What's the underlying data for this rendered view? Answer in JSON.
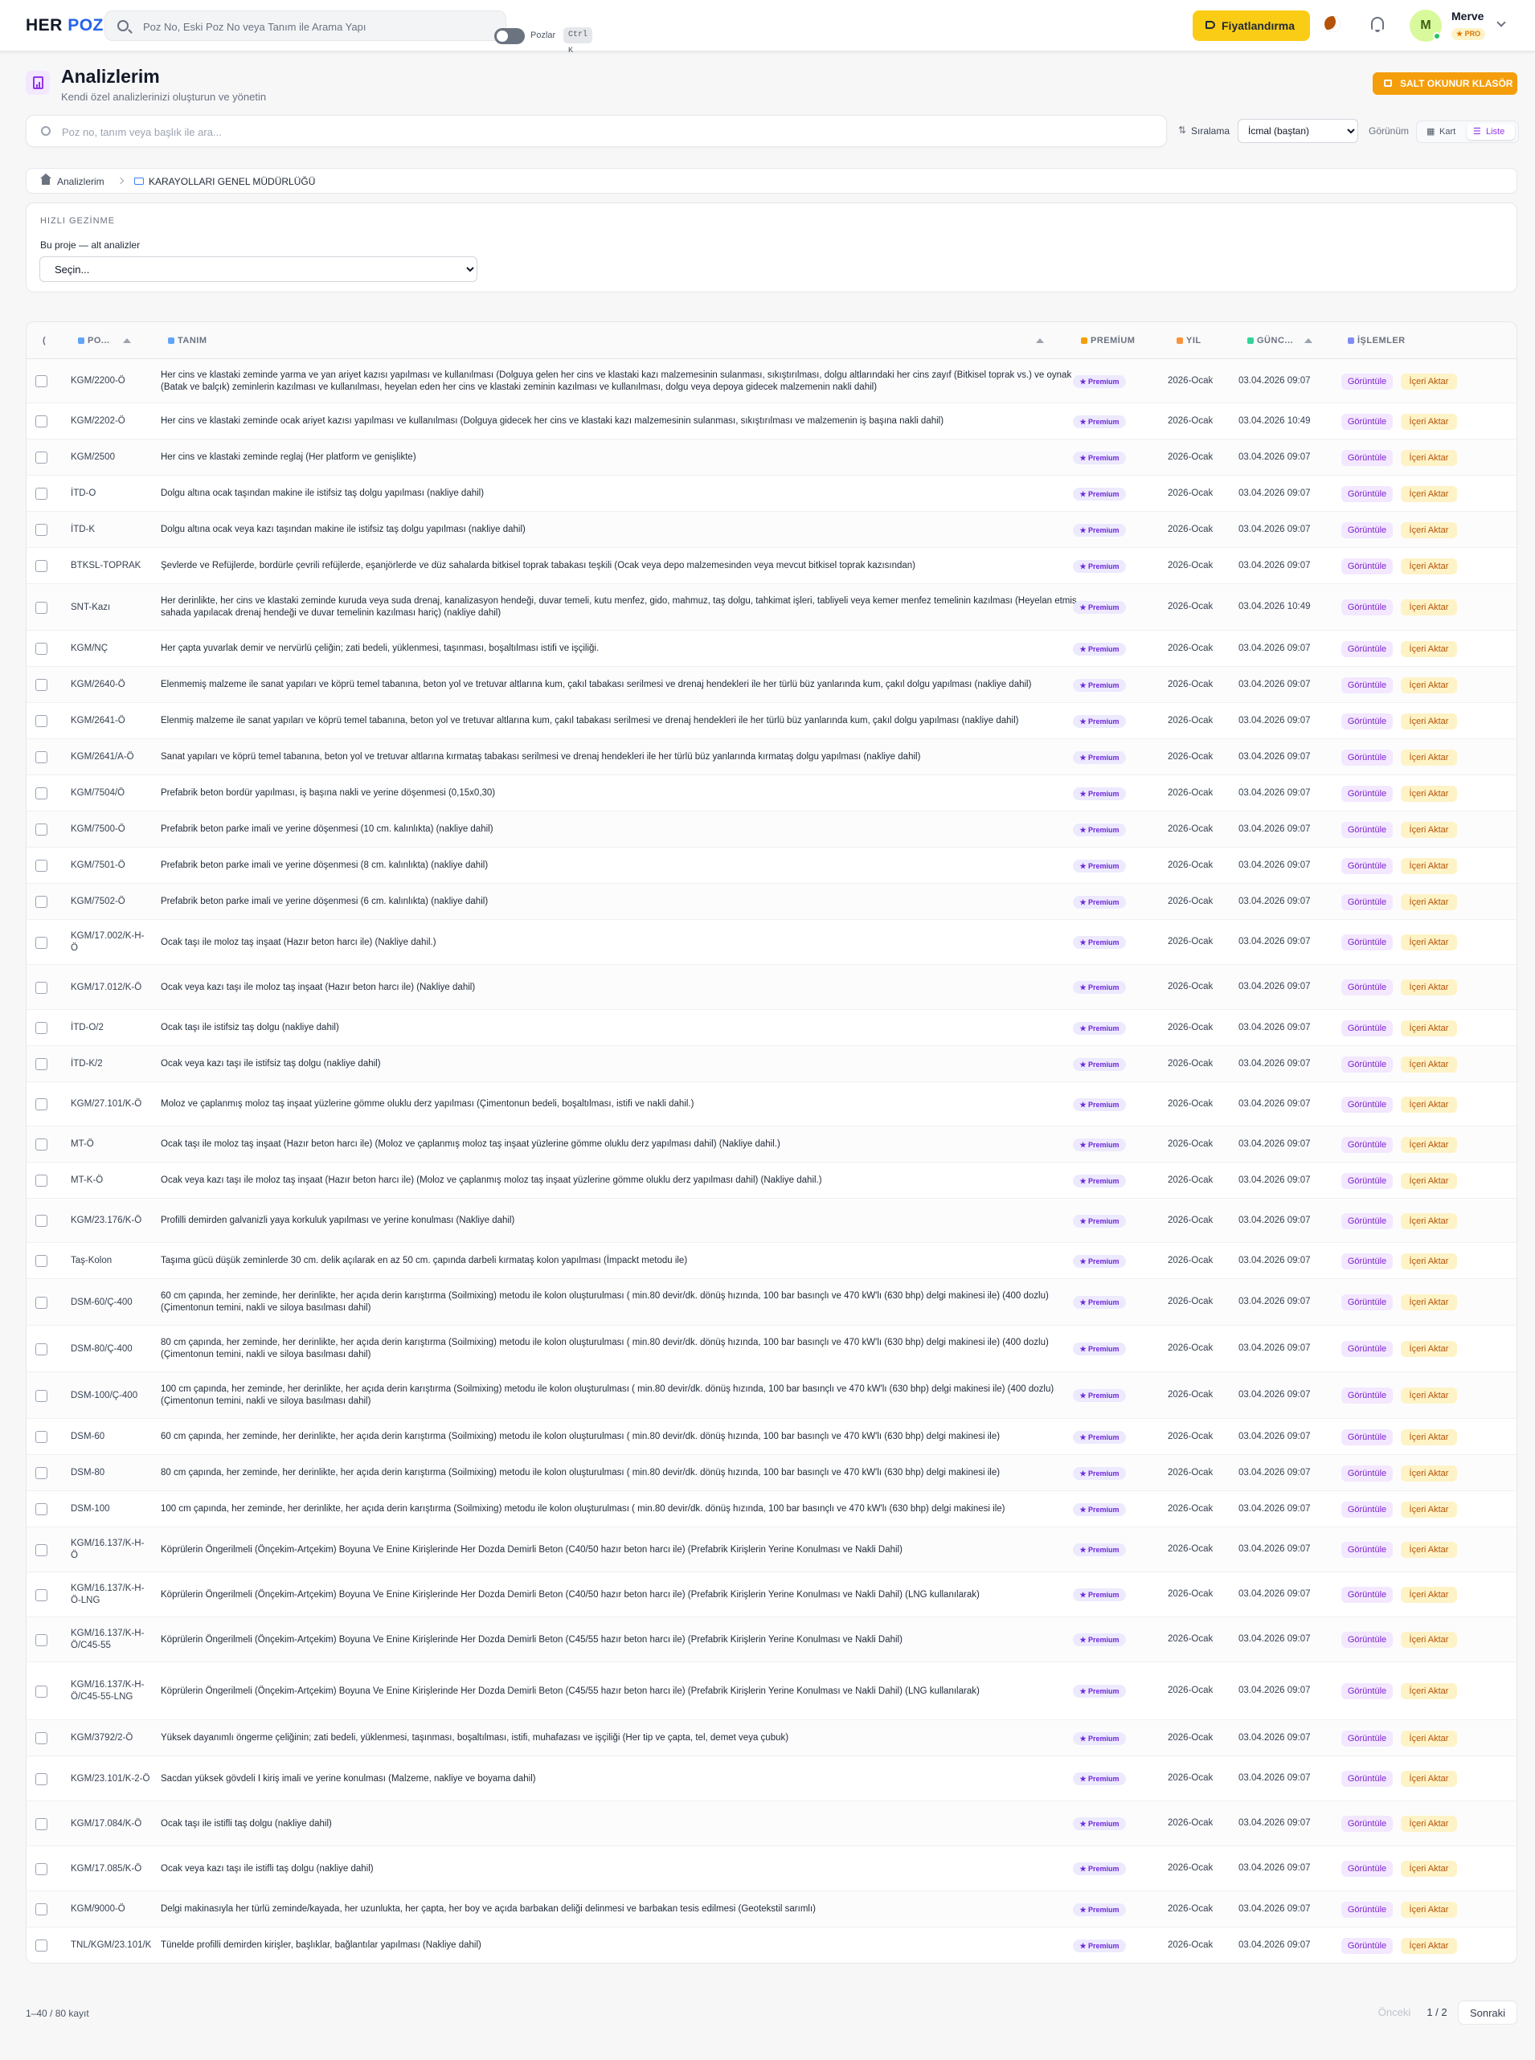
{
  "topbar": {
    "logo_a": "HER",
    "logo_b": "POZ",
    "search_placeholder": "Poz No, Eski Poz No veya Tanım ile Arama Yapı",
    "toggle_label": "Pozlar",
    "shortcut": "Ctrl K",
    "pricing_label": "Fiyatlandırma",
    "user_initial": "M",
    "user_name": "Merve",
    "user_plan": "★ PRO"
  },
  "header": {
    "title": "Analizlerim",
    "subtitle": "Kendi özel analizlerinizi oluşturun ve yönetin",
    "readonly_label": "SALT OKUNUR KLASÖR"
  },
  "filter": {
    "search_placeholder": "Poz no, tanım veya başlık ile ara...",
    "sort_label": "Sıralama",
    "sort_value": "İcmal (baştan)",
    "view_label": "Görünüm",
    "view_card": "Kart",
    "view_list": "Liste"
  },
  "breadcrumb": {
    "root": "Analizlerim",
    "current": "KARAYOLLARI GENEL MÜDÜRLÜĞÜ"
  },
  "quick_nav": {
    "title": "HIZLI GEZİNME",
    "label": "Bu proje — alt analizler",
    "select_value": "Seçin..."
  },
  "table": {
    "headers": {
      "sel": "(",
      "poz": "PO...",
      "tanim": "TANIM",
      "premium": "PREMİUM",
      "yil": "YIL",
      "guncel": "GÜNC...",
      "islemler": "İŞLEMLER"
    },
    "rows": [
      {
        "poz": "KGM/2200-Ö",
        "tanim": "Her cins ve klastaki zeminde yarma ve yan ariyet kazısı yapılması ve kullanılması (Dolguya gelen her cins ve klastaki kazı malzemesinin sulanması, sıkıştırılması, dolgu altlarındaki her cins zayıf (Bitkisel toprak vs.) ve oynak (Batak ve balçık) zeminlerin kazılması ve kullanılması, heyelan eden her cins ve klastaki zeminin kazılması ve kullanılması, dolgu veya depoya gidecek malzemenin nakli dahil)",
        "premium": "★ Premium",
        "yil": "2026-Ocak",
        "guncel": "03.04.2026 09:07",
        "view": "Görüntüle",
        "import": "İçeri Aktar"
      },
      {
        "poz": "KGM/2202-Ö",
        "tanim": "Her cins ve klastaki zeminde ocak ariyet kazısı yapılması ve kullanılması (Dolguya gidecek her cins ve klastaki kazı malzemesinin sulanması, sıkıştırılması ve malzemenin iş başına nakli dahil)",
        "premium": "★ Premium",
        "yil": "2026-Ocak",
        "guncel": "03.04.2026 10:49",
        "view": "Görüntüle",
        "import": "İçeri Aktar"
      },
      {
        "poz": "KGM/2500",
        "tanim": "Her cins ve klastaki zeminde reglaj (Her platform ve genişlikte)",
        "premium": "★ Premium",
        "yil": "2026-Ocak",
        "guncel": "03.04.2026 09:07",
        "view": "Görüntüle",
        "import": "İçeri Aktar"
      },
      {
        "poz": "İTD-O",
        "tanim": "Dolgu altına ocak taşından makine ile istifsiz taş dolgu yapılması (nakliye dahil)",
        "premium": "★ Premium",
        "yil": "2026-Ocak",
        "guncel": "03.04.2026 09:07",
        "view": "Görüntüle",
        "import": "İçeri Aktar"
      },
      {
        "poz": "İTD-K",
        "tanim": "Dolgu altına ocak veya kazı taşından makine ile istifsiz taş dolgu yapılması (nakliye dahil)",
        "premium": "★ Premium",
        "yil": "2026-Ocak",
        "guncel": "03.04.2026 09:07",
        "view": "Görüntüle",
        "import": "İçeri Aktar"
      },
      {
        "poz": "BTKSL-TOPRAK",
        "tanim": "Şevlerde ve Refüjlerde, bordürle çevrili refüjlerde, eşanjörlerde ve düz sahalarda bitkisel toprak tabakası teşkili (Ocak veya depo malzemesinden veya mevcut bitkisel toprak kazısından)",
        "premium": "★ Premium",
        "yil": "2026-Ocak",
        "guncel": "03.04.2026 09:07",
        "view": "Görüntüle",
        "import": "İçeri Aktar"
      },
      {
        "poz": "SNT-Kazı",
        "tanim": "Her derinlikte, her cins ve klastaki zeminde kuruda veya suda drenaj, kanalizasyon hendeği, duvar temeli, kutu menfez, gido, mahmuz, taş dolgu, tahkimat işleri, tabliyeli veya kemer menfez temelinin kazılması (Heyelan etmiş sahada yapılacak drenaj hendeği ve duvar temelinin kazılması hariç) (nakliye dahil)",
        "premium": "★ Premium",
        "yil": "2026-Ocak",
        "guncel": "03.04.2026 10:49",
        "view": "Görüntüle",
        "import": "İçeri Aktar"
      },
      {
        "poz": "KGM/NÇ",
        "tanim": "Her çapta yuvarlak demir ve nervürlü çeliğin; zati bedeli, yüklenmesi, taşınması, boşaltılması istifi ve işçiliği.",
        "premium": "★ Premium",
        "yil": "2026-Ocak",
        "guncel": "03.04.2026 09:07",
        "view": "Görüntüle",
        "import": "İçeri Aktar"
      },
      {
        "poz": "KGM/2640-Ö",
        "tanim": "Elenmemiş malzeme ile sanat yapıları ve köprü temel tabanına, beton yol ve tretuvar altlarına kum, çakıl tabakası serilmesi ve drenaj hendekleri ile her türlü büz yanlarında kum, çakıl dolgu yapılması (nakliye dahil)",
        "premium": "★ Premium",
        "yil": "2026-Ocak",
        "guncel": "03.04.2026 09:07",
        "view": "Görüntüle",
        "import": "İçeri Aktar"
      },
      {
        "poz": "KGM/2641-Ö",
        "tanim": "Elenmiş malzeme ile sanat yapıları ve köprü temel tabanına, beton yol ve tretuvar altlarına kum, çakıl tabakası serilmesi ve drenaj hendekleri ile her türlü büz yanlarında kum, çakıl dolgu yapılması (nakliye dahil)",
        "premium": "★ Premium",
        "yil": "2026-Ocak",
        "guncel": "03.04.2026 09:07",
        "view": "Görüntüle",
        "import": "İçeri Aktar"
      },
      {
        "poz": "KGM/2641/A-Ö",
        "tanim": "Sanat yapıları ve köprü temel tabanına, beton yol ve tretuvar altlarına kırmataş tabakası serilmesi ve drenaj hendekleri ile her türlü büz yanlarında kırmataş dolgu yapılması (nakliye dahil)",
        "premium": "★ Premium",
        "yil": "2026-Ocak",
        "guncel": "03.04.2026 09:07",
        "view": "Görüntüle",
        "import": "İçeri Aktar"
      },
      {
        "poz": "KGM/7504/Ö",
        "tanim": "Prefabrik beton bordür yapılması, iş başına nakli ve yerine döşenmesi (0,15x0,30)",
        "premium": "★ Premium",
        "yil": "2026-Ocak",
        "guncel": "03.04.2026 09:07",
        "view": "Görüntüle",
        "import": "İçeri Aktar"
      },
      {
        "poz": "KGM/7500-Ö",
        "tanim": "Prefabrik beton parke imali ve yerine döşenmesi (10 cm. kalınlıkta) (nakliye dahil)",
        "premium": "★ Premium",
        "yil": "2026-Ocak",
        "guncel": "03.04.2026 09:07",
        "view": "Görüntüle",
        "import": "İçeri Aktar"
      },
      {
        "poz": "KGM/7501-Ö",
        "tanim": "Prefabrik beton parke imali ve yerine döşenmesi (8 cm. kalınlıkta) (nakliye dahil)",
        "premium": "★ Premium",
        "yil": "2026-Ocak",
        "guncel": "03.04.2026 09:07",
        "view": "Görüntüle",
        "import": "İçeri Aktar"
      },
      {
        "poz": "KGM/7502-Ö",
        "tanim": "Prefabrik beton parke imali ve yerine döşenmesi (6 cm. kalınlıkta) (nakliye dahil)",
        "premium": "★ Premium",
        "yil": "2026-Ocak",
        "guncel": "03.04.2026 09:07",
        "view": "Görüntüle",
        "import": "İçeri Aktar"
      },
      {
        "poz": "KGM/17.002/K-H-Ö",
        "tanim": "Ocak taşı ile moloz taş inşaat (Hazır beton harcı ile) (Nakliye dahil.)",
        "premium": "★ Premium",
        "yil": "2026-Ocak",
        "guncel": "03.04.2026 09:07",
        "view": "Görüntüle",
        "import": "İçeri Aktar"
      },
      {
        "poz": "KGM/17.012/K-Ö",
        "tanim": "Ocak veya kazı taşı ile moloz taş inşaat (Hazır beton harcı ile) (Nakliye dahil)",
        "premium": "★ Premium",
        "yil": "2026-Ocak",
        "guncel": "03.04.2026 09:07",
        "view": "Görüntüle",
        "import": "İçeri Aktar"
      },
      {
        "poz": "İTD-O/2",
        "tanim": "Ocak taşı ile istifsiz taş dolgu (nakliye dahil)",
        "premium": "★ Premium",
        "yil": "2026-Ocak",
        "guncel": "03.04.2026 09:07",
        "view": "Görüntüle",
        "import": "İçeri Aktar"
      },
      {
        "poz": "İTD-K/2",
        "tanim": "Ocak veya kazı taşı ile istifsiz taş dolgu (nakliye dahil)",
        "premium": "★ Premium",
        "yil": "2026-Ocak",
        "guncel": "03.04.2026 09:07",
        "view": "Görüntüle",
        "import": "İçeri Aktar"
      },
      {
        "poz": "KGM/27.101/K-Ö",
        "tanim": "Moloz ve çaplanmış moloz taş inşaat yüzlerine gömme oluklu derz yapılması (Çimentonun bedeli, boşaltılması, istifi ve nakli dahil.)",
        "premium": "★ Premium",
        "yil": "2026-Ocak",
        "guncel": "03.04.2026 09:07",
        "view": "Görüntüle",
        "import": "İçeri Aktar"
      },
      {
        "poz": "MT-Ö",
        "tanim": "Ocak taşı ile moloz taş inşaat (Hazır beton harcı ile) (Moloz ve çaplanmış moloz taş inşaat yüzlerine gömme oluklu derz yapılması dahil) (Nakliye dahil.)",
        "premium": "★ Premium",
        "yil": "2026-Ocak",
        "guncel": "03.04.2026 09:07",
        "view": "Görüntüle",
        "import": "İçeri Aktar"
      },
      {
        "poz": "MT-K-Ö",
        "tanim": "Ocak veya kazı taşı ile moloz taş inşaat (Hazır beton harcı ile) (Moloz ve çaplanmış moloz taş inşaat yüzlerine gömme oluklu derz yapılması dahil) (Nakliye dahil.)",
        "premium": "★ Premium",
        "yil": "2026-Ocak",
        "guncel": "03.04.2026 09:07",
        "view": "Görüntüle",
        "import": "İçeri Aktar"
      },
      {
        "poz": "KGM/23.176/K-Ö",
        "tanim": "Profilli demirden galvanizli yaya korkuluk yapılması ve yerine konulması (Nakliye dahil)",
        "premium": "★ Premium",
        "yil": "2026-Ocak",
        "guncel": "03.04.2026 09:07",
        "view": "Görüntüle",
        "import": "İçeri Aktar"
      },
      {
        "poz": "Taş-Kolon",
        "tanim": "Taşıma gücü düşük zeminlerde 30 cm. delik açılarak en az 50 cm. çapında darbeli kırmataş kolon yapılması (İmpackt metodu ile)",
        "premium": "★ Premium",
        "yil": "2026-Ocak",
        "guncel": "03.04.2026 09:07",
        "view": "Görüntüle",
        "import": "İçeri Aktar"
      },
      {
        "poz": "DSM-60/Ç-400",
        "tanim": "60 cm çapında, her zeminde, her derinlikte, her açıda derin karıştırma (Soilmixing) metodu ile kolon oluşturulması ( min.80 devir/dk. dönüş hızında, 100 bar basınçlı ve 470 kW'lı (630 bhp) delgi makinesi ile) (400 dozlu) (Çimentonun temini, nakli ve siloya basılması dahil)",
        "premium": "★ Premium",
        "yil": "2026-Ocak",
        "guncel": "03.04.2026 09:07",
        "view": "Görüntüle",
        "import": "İçeri Aktar"
      },
      {
        "poz": "DSM-80/Ç-400",
        "tanim": "80 cm çapında, her zeminde, her derinlikte, her açıda derin karıştırma (Soilmixing) metodu ile kolon oluşturulması ( min.80 devir/dk. dönüş hızında, 100 bar basınçlı ve 470 kW'lı (630 bhp) delgi makinesi ile) (400 dozlu) (Çimentonun temini, nakli ve siloya basılması dahil)",
        "premium": "★ Premium",
        "yil": "2026-Ocak",
        "guncel": "03.04.2026 09:07",
        "view": "Görüntüle",
        "import": "İçeri Aktar"
      },
      {
        "poz": "DSM-100/Ç-400",
        "tanim": "100 cm çapında, her zeminde, her derinlikte, her açıda derin karıştırma (Soilmixing) metodu ile kolon oluşturulması ( min.80 devir/dk. dönüş hızında, 100 bar basınçlı ve 470 kW'lı (630 bhp) delgi makinesi ile) (400 dozlu) (Çimentonun temini, nakli ve siloya basılması dahil)",
        "premium": "★ Premium",
        "yil": "2026-Ocak",
        "guncel": "03.04.2026 09:07",
        "view": "Görüntüle",
        "import": "İçeri Aktar"
      },
      {
        "poz": "DSM-60",
        "tanim": "60 cm çapında, her zeminde, her derinlikte, her açıda derin karıştırma (Soilmixing) metodu ile kolon oluşturulması ( min.80 devir/dk. dönüş hızında, 100 bar basınçlı ve 470 kW'lı (630 bhp) delgi makinesi ile)",
        "premium": "★ Premium",
        "yil": "2026-Ocak",
        "guncel": "03.04.2026 09:07",
        "view": "Görüntüle",
        "import": "İçeri Aktar"
      },
      {
        "poz": "DSM-80",
        "tanim": "80 cm çapında, her zeminde, her derinlikte, her açıda derin karıştırma (Soilmixing) metodu ile kolon oluşturulması ( min.80 devir/dk. dönüş hızında, 100 bar basınçlı ve 470 kW'lı (630 bhp) delgi makinesi ile)",
        "premium": "★ Premium",
        "yil": "2026-Ocak",
        "guncel": "03.04.2026 09:07",
        "view": "Görüntüle",
        "import": "İçeri Aktar"
      },
      {
        "poz": "DSM-100",
        "tanim": "100 cm çapında, her zeminde, her derinlikte, her açıda derin karıştırma (Soilmixing) metodu ile kolon oluşturulması ( min.80 devir/dk. dönüş hızında, 100 bar basınçlı ve 470 kW'lı (630 bhp) delgi makinesi ile)",
        "premium": "★ Premium",
        "yil": "2026-Ocak",
        "guncel": "03.04.2026 09:07",
        "view": "Görüntüle",
        "import": "İçeri Aktar"
      },
      {
        "poz": "KGM/16.137/K-H-Ö",
        "tanim": "Köprülerin Öngerilmeli (Önçekim-Artçekim) Boyuna Ve Enine Kirişlerinde Her Dozda Demirli Beton (C40/50 hazır beton harcı ile) (Prefabrik Kirişlerin Yerine Konulması ve Nakli Dahil)",
        "premium": "★ Premium",
        "yil": "2026-Ocak",
        "guncel": "03.04.2026 09:07",
        "view": "Görüntüle",
        "import": "İçeri Aktar"
      },
      {
        "poz": "KGM/16.137/K-H-Ö-LNG",
        "tanim": "Köprülerin Öngerilmeli (Önçekim-Artçekim) Boyuna Ve Enine Kirişlerinde Her Dozda Demirli Beton (C40/50 hazır beton harcı ile) (Prefabrik Kirişlerin Yerine Konulması ve Nakli Dahil) (LNG kullanılarak)",
        "premium": "★ Premium",
        "yil": "2026-Ocak",
        "guncel": "03.04.2026 09:07",
        "view": "Görüntüle",
        "import": "İçeri Aktar"
      },
      {
        "poz": "KGM/16.137/K-H-Ö/C45-55",
        "tanim": "Köprülerin Öngerilmeli (Önçekim-Artçekim) Boyuna Ve Enine Kirişlerinde Her Dozda Demirli Beton (C45/55 hazır beton harcı ile) (Prefabrik Kirişlerin Yerine Konulması ve Nakli Dahil)",
        "premium": "★ Premium",
        "yil": "2026-Ocak",
        "guncel": "03.04.2026 09:07",
        "view": "Görüntüle",
        "import": "İçeri Aktar"
      },
      {
        "poz": "KGM/16.137/K-H-Ö/C45-55-LNG",
        "tanim": "Köprülerin Öngerilmeli (Önçekim-Artçekim) Boyuna Ve Enine Kirişlerinde Her Dozda Demirli Beton (C45/55 hazır beton harcı ile) (Prefabrik Kirişlerin Yerine Konulması ve Nakli Dahil) (LNG kullanılarak)",
        "premium": "★ Premium",
        "yil": "2026-Ocak",
        "guncel": "03.04.2026 09:07",
        "view": "Görüntüle",
        "import": "İçeri Aktar"
      },
      {
        "poz": "KGM/3792/2-Ö",
        "tanim": "Yüksek dayanımlı öngerme çeliğinin; zati bedeli, yüklenmesi, taşınması, boşaltılması, istifi, muhafazası ve işçiliği (Her tip ve çapta, tel, demet veya çubuk)",
        "premium": "★ Premium",
        "yil": "2026-Ocak",
        "guncel": "03.04.2026 09:07",
        "view": "Görüntüle",
        "import": "İçeri Aktar"
      },
      {
        "poz": "KGM/23.101/K-2-Ö",
        "tanim": "Sacdan yüksek gövdeli I kiriş imali ve yerine konulması (Malzeme, nakliye ve boyama dahil)",
        "premium": "★ Premium",
        "yil": "2026-Ocak",
        "guncel": "03.04.2026 09:07",
        "view": "Görüntüle",
        "import": "İçeri Aktar"
      },
      {
        "poz": "KGM/17.084/K-Ö",
        "tanim": "Ocak taşı ile istifli taş dolgu (nakliye dahil)",
        "premium": "★ Premium",
        "yil": "2026-Ocak",
        "guncel": "03.04.2026 09:07",
        "view": "Görüntüle",
        "import": "İçeri Aktar"
      },
      {
        "poz": "KGM/17.085/K-Ö",
        "tanim": "Ocak veya kazı taşı ile istifli taş dolgu (nakliye dahil)",
        "premium": "★ Premium",
        "yil": "2026-Ocak",
        "guncel": "03.04.2026 09:07",
        "view": "Görüntüle",
        "import": "İçeri Aktar"
      },
      {
        "poz": "KGM/9000-Ö",
        "tanim": "Delgi makinasıyla her türlü zeminde/kayada, her uzunlukta, her çapta, her boy ve açıda barbakan deliği delinmesi ve barbakan tesis edilmesi (Geotekstil sarımlı)",
        "premium": "★ Premium",
        "yil": "2026-Ocak",
        "guncel": "03.04.2026 09:07",
        "view": "Görüntüle",
        "import": "İçeri Aktar"
      },
      {
        "poz": "TNL/KGM/23.101/K",
        "tanim": "Tünelde profilli demirden kirişler, başlıklar, bağlantılar yapılması (Nakliye dahil)",
        "premium": "★ Premium",
        "yil": "2026-Ocak",
        "guncel": "03.04.2026 09:07",
        "view": "Görüntüle",
        "import": "İçeri Aktar"
      }
    ]
  },
  "footer": {
    "count": "1–40 / 80 kayıt",
    "prev": "Önceki",
    "page": "1 / 2",
    "next": "Sonraki"
  }
}
